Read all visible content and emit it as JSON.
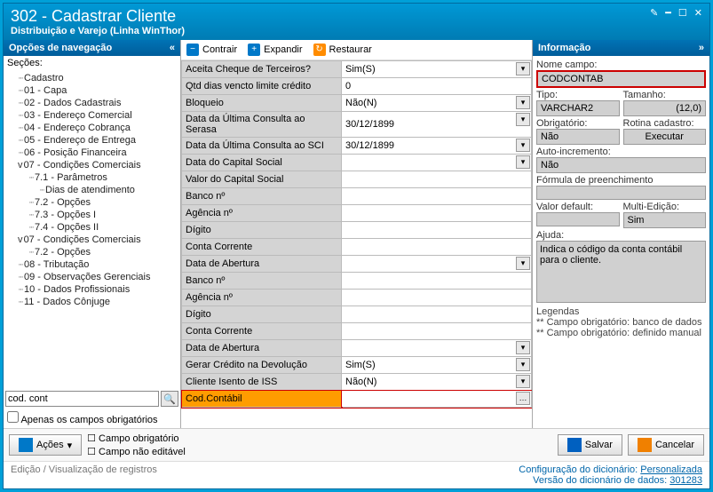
{
  "title": "302 - Cadastrar Cliente",
  "subtitle": "Distribuição e Varejo (Linha WinThor)",
  "nav": {
    "header": "Opções de navegação",
    "sections_label": "Seções:",
    "items": [
      "Cadastro",
      "01 - Capa",
      "02 - Dados Cadastrais",
      "03 - Endereço Comercial",
      "04 - Endereço Cobrança",
      "05 - Endereço de Entrega",
      "06 - Posição Financeira",
      "07 - Condições Comerciais",
      "7.1 - Parâmetros",
      "Dias de atendimento",
      "7.2 - Opções",
      "7.3 - Opções I",
      "7.4 - Opções II",
      "07 - Condições Comerciais",
      "7.2 - Opções",
      "08 - Tributação",
      "09 - Observações Gerenciais",
      "10 - Dados Profissionais",
      "11 - Dados Cônjuge"
    ],
    "search_value": "cod. cont",
    "filter_label": "Apenas os campos obrigatórios"
  },
  "toolbar": {
    "contrair": "Contrair",
    "expandir": "Expandir",
    "restaurar": "Restaurar"
  },
  "grid": [
    {
      "label": "Aceita Cheque de Terceiros?",
      "value": "Sim(S)",
      "dd": true
    },
    {
      "label": "Qtd dias vencto limite crédito",
      "value": "0",
      "dd": false
    },
    {
      "label": "Bloqueio",
      "value": "Não(N)",
      "dd": true
    },
    {
      "label": "Data da Última Consulta ao Serasa",
      "value": "30/12/1899",
      "dd": true
    },
    {
      "label": "Data da Última Consulta ao SCI",
      "value": "30/12/1899",
      "dd": true
    },
    {
      "label": "Data do Capital Social",
      "value": "",
      "dd": true
    },
    {
      "label": "Valor do Capital Social",
      "value": "",
      "dd": false
    },
    {
      "label": "Banco nº",
      "value": "",
      "dd": false
    },
    {
      "label": "Agência nº",
      "value": "",
      "dd": false
    },
    {
      "label": "Dígito",
      "value": "",
      "dd": false
    },
    {
      "label": "Conta Corrente",
      "value": "",
      "dd": false
    },
    {
      "label": "Data de Abertura",
      "value": "",
      "dd": true
    },
    {
      "label": "Banco nº",
      "value": "",
      "dd": false
    },
    {
      "label": "Agência nº",
      "value": "",
      "dd": false
    },
    {
      "label": "Dígito",
      "value": "",
      "dd": false
    },
    {
      "label": "Conta Corrente",
      "value": "",
      "dd": false
    },
    {
      "label": "Data de Abertura",
      "value": "",
      "dd": true
    },
    {
      "label": "Gerar Crédito na Devolução",
      "value": "Sim(S)",
      "dd": true
    },
    {
      "label": "Cliente Isento de ISS",
      "value": "Não(N)",
      "dd": true
    },
    {
      "label": "Cod.Contábil",
      "value": "",
      "dd": false,
      "hl": true,
      "btn": true
    }
  ],
  "info": {
    "header": "Informação",
    "nome_campo_label": "Nome campo:",
    "nome_campo": "CODCONTAB",
    "tipo_label": "Tipo:",
    "tipo": "VARCHAR2",
    "tamanho_label": "Tamanho:",
    "tamanho": "(12,0)",
    "obrig_label": "Obrigatório:",
    "obrig": "Não",
    "rotina_label": "Rotina cadastro:",
    "rotina_btn": "Executar",
    "auto_label": "Auto-incremento:",
    "auto": "Não",
    "formula_label": "Fórmula de preenchimento",
    "formula": "",
    "default_label": "Valor default:",
    "default": "",
    "multi_label": "Multi-Edição:",
    "multi": "Sim",
    "ajuda_label": "Ajuda:",
    "ajuda": "Indica o código da conta contábil para o cliente.",
    "legendas": "Legendas",
    "leg1": "** Campo obrigatório: banco de dados",
    "leg2": "** Campo obrigatório: definido manual"
  },
  "footer": {
    "acoes": "Ações",
    "chk1": "Campo obrigatório",
    "chk2": "Campo não editável",
    "salvar": "Salvar",
    "cancelar": "Cancelar"
  },
  "status": {
    "left": "Edição / Visualização de registros",
    "r1a": "Configuração do dicionário:",
    "r1b": "Personalizada",
    "r2a": "Versão do dicionário de dados:",
    "r2b": "301283"
  }
}
